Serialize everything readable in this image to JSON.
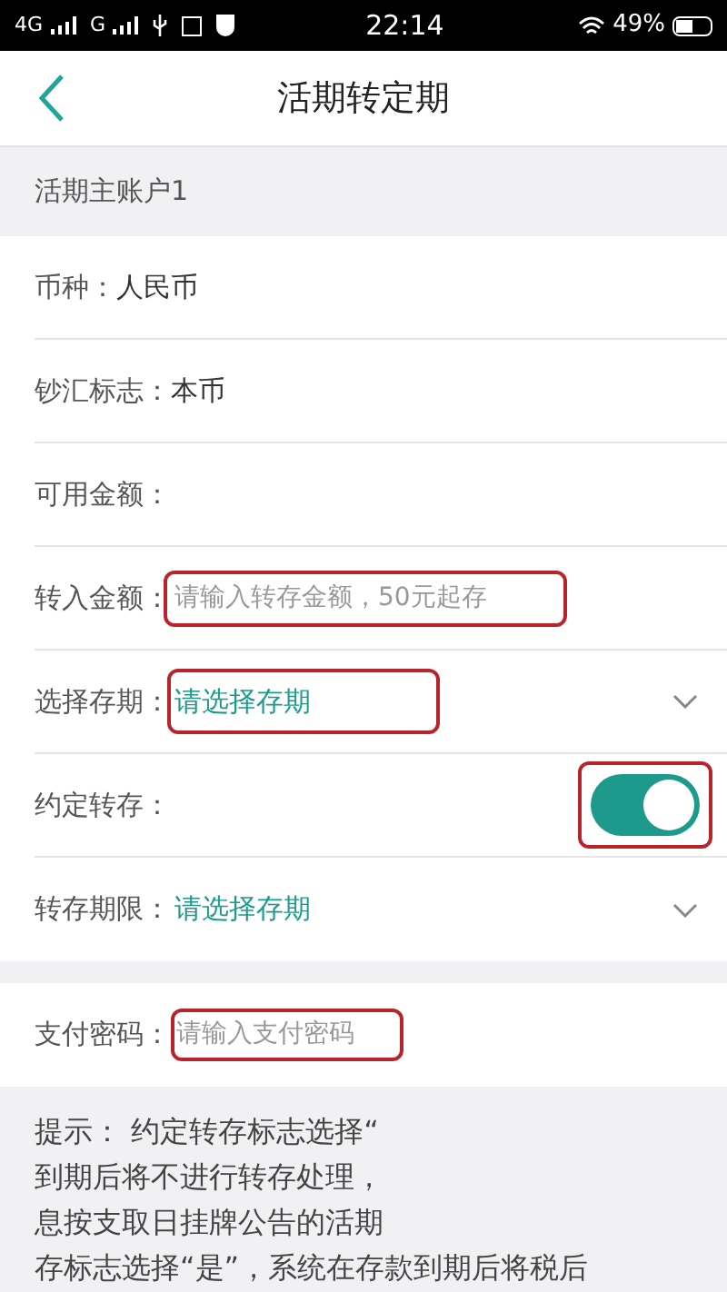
{
  "status_bar": {
    "network_1": "4G",
    "network_2": "G",
    "time": "22:14",
    "battery": "49%"
  },
  "header": {
    "title": "活期转定期"
  },
  "account": {
    "label": "活期主账户1"
  },
  "rows": [
    {
      "kind": "text",
      "label": "币种：",
      "value": "人民币"
    },
    {
      "kind": "text",
      "label": "钞汇标志：",
      "value": "本币"
    },
    {
      "kind": "text",
      "label": "可用金额："
    },
    {
      "kind": "input",
      "label": "转入金额：",
      "placeholder": "请输入转存金额，50元起存",
      "highlighted": true
    },
    {
      "kind": "select",
      "label": "选择存期：",
      "value": "请选择存期",
      "highlighted": true
    },
    {
      "kind": "switch",
      "label": "约定转存：",
      "on": true,
      "highlighted": true
    },
    {
      "kind": "select",
      "label": "转存期限：",
      "value": "请选择存期",
      "highlighted": false
    }
  ],
  "password": {
    "label": "支付密码：",
    "placeholder": "请输入支付密码",
    "highlighted": true
  },
  "hint_lines": [
    "提示： 约定转存标志选择“",
    "到期后将不进行转存处理，",
    "息按支取日挂牌公告的活期",
    "存标志选择“是”，系统在存款到期后将税后"
  ]
}
